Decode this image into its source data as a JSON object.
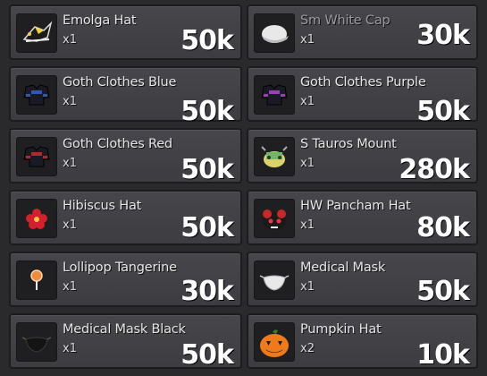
{
  "items": [
    {
      "name": "Emolga Hat",
      "qty": "x1",
      "price": "50k",
      "icon": "emolga-hat-icon"
    },
    {
      "name": "Sm White Cap",
      "qty": "x1",
      "price": "30k",
      "icon": "white-cap-icon",
      "dim": true
    },
    {
      "name": "Goth Clothes Blue",
      "qty": "x1",
      "price": "50k",
      "icon": "goth-clothes-blue-icon"
    },
    {
      "name": "Goth Clothes Purple",
      "qty": "x1",
      "price": "50k",
      "icon": "goth-clothes-purple-icon"
    },
    {
      "name": "Goth Clothes Red",
      "qty": "x1",
      "price": "50k",
      "icon": "goth-clothes-red-icon"
    },
    {
      "name": "S Tauros Mount",
      "qty": "x1",
      "price": "280k",
      "icon": "tauros-mount-icon"
    },
    {
      "name": "Hibiscus Hat",
      "qty": "x1",
      "price": "50k",
      "icon": "hibiscus-hat-icon"
    },
    {
      "name": "HW Pancham Hat",
      "qty": "x1",
      "price": "80k",
      "icon": "pancham-hat-icon"
    },
    {
      "name": "Lollipop Tangerine",
      "qty": "x1",
      "price": "30k",
      "icon": "lollipop-icon"
    },
    {
      "name": "Medical Mask",
      "qty": "x1",
      "price": "50k",
      "icon": "medical-mask-icon"
    },
    {
      "name": "Medical Mask Black",
      "qty": "x1",
      "price": "50k",
      "icon": "medical-mask-black-icon"
    },
    {
      "name": "Pumpkin Hat",
      "qty": "x2",
      "price": "10k",
      "icon": "pumpkin-hat-icon"
    }
  ],
  "colors": {
    "card_bg": "#424247",
    "card_border": "#1c1c1f",
    "page_bg": "#2a2a2d",
    "text": "#e6e6e6",
    "price": "#ffffff"
  }
}
